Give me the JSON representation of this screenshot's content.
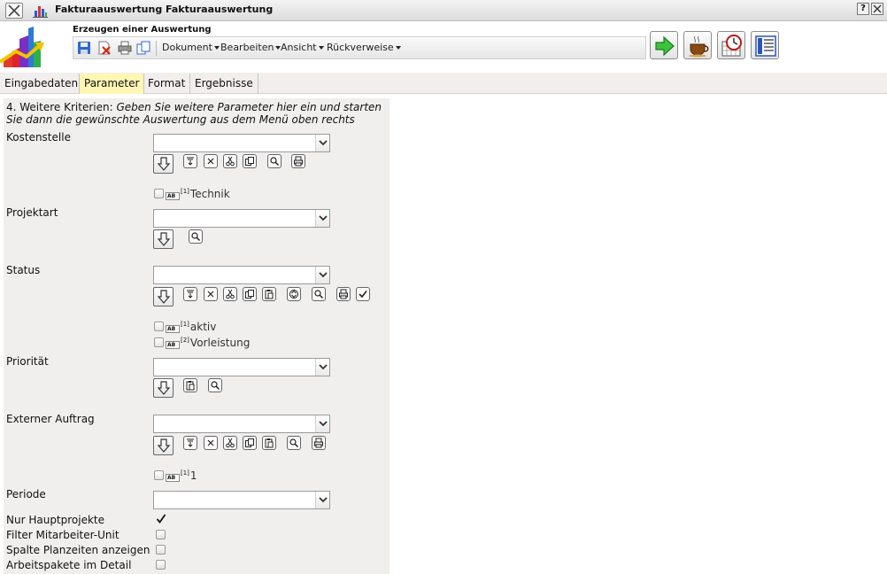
{
  "window": {
    "title": "Fakturaauswertung Fakturaauswertung",
    "help_label": "?"
  },
  "header": {
    "subtitle": "Erzeugen einer Auswertung",
    "menus": [
      "Dokument",
      "Bearbeiten",
      "Ansicht",
      "Rückverweise"
    ]
  },
  "tabs": [
    {
      "label": "Eingabedaten",
      "active": false
    },
    {
      "label": "Parameter",
      "active": true
    },
    {
      "label": "Format",
      "active": false
    },
    {
      "label": "Ergebnisse",
      "active": false
    }
  ],
  "form": {
    "intro_prefix": "4. Weitere Kriterien: ",
    "intro_text": "Geben Sie weitere Parameter hier ein und starten Sie dann die gewünschte Auswertung aus dem Menü oben rechts",
    "fields": [
      {
        "label": "Kostenstelle",
        "value": "",
        "entries": [
          {
            "index": "[1]",
            "text": "Technik"
          }
        ]
      },
      {
        "label": "Projektart",
        "value": "",
        "entries": []
      },
      {
        "label": "Status",
        "value": "",
        "entries": [
          {
            "index": "[1]",
            "text": "aktiv"
          },
          {
            "index": "[2]",
            "text": "Vorleistung"
          }
        ]
      },
      {
        "label": "Priorität",
        "value": "",
        "entries": []
      },
      {
        "label": "Externer Auftrag",
        "value": "",
        "entries": [
          {
            "index": "[1]",
            "text": "1"
          }
        ]
      },
      {
        "label": "Periode",
        "value": "",
        "entries": []
      }
    ],
    "checkboxes": [
      {
        "label": "Nur Hauptprojekte",
        "checked": true
      },
      {
        "label": "Filter Mitarbeiter-Unit",
        "checked": false
      },
      {
        "label": "Spalte Planzeiten anzeigen",
        "checked": false
      },
      {
        "label": "Arbeitspakete im Detail",
        "checked": false
      }
    ],
    "ab_badge": "AB"
  }
}
